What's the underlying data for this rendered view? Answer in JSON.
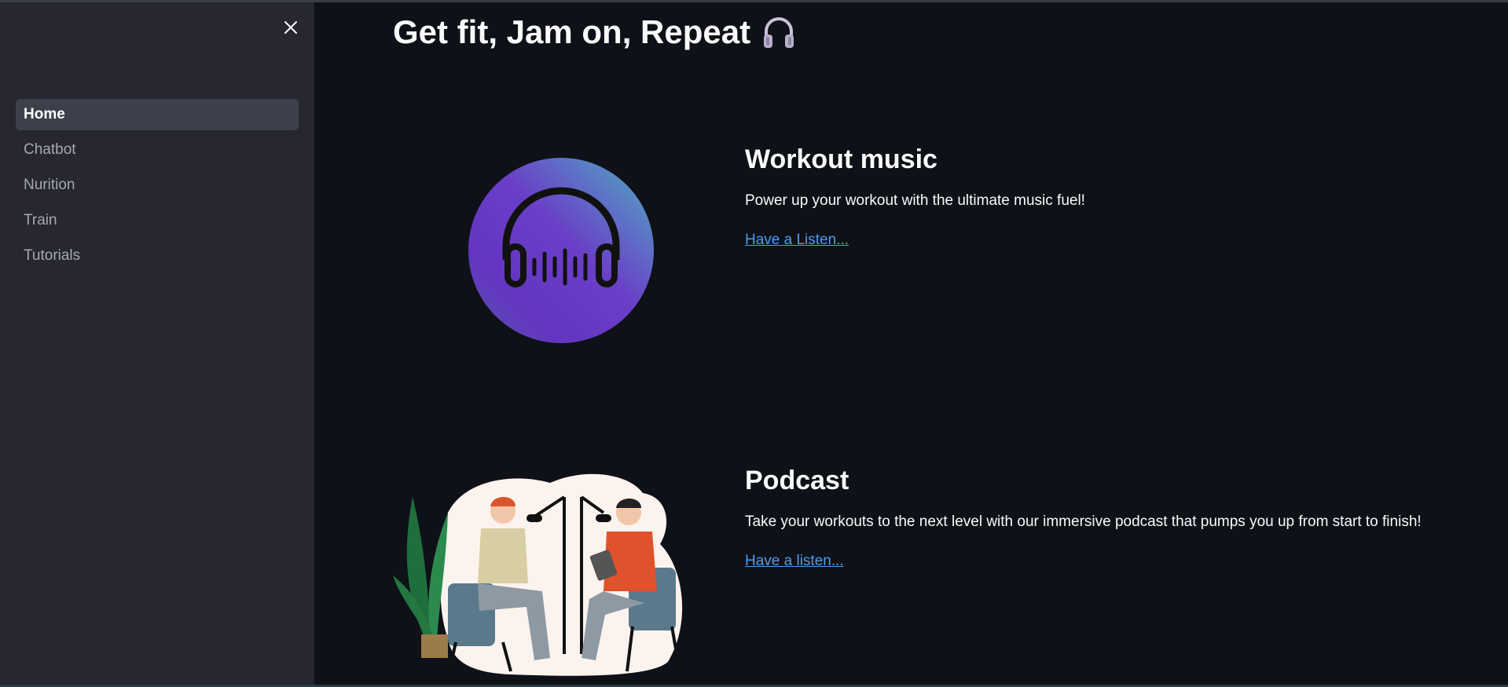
{
  "sidebar": {
    "close_icon": "close-icon",
    "items": [
      {
        "label": "Home",
        "active": true
      },
      {
        "label": "Chatbot",
        "active": false
      },
      {
        "label": "Nurition",
        "active": false
      },
      {
        "label": "Train",
        "active": false
      },
      {
        "label": "Tutorials",
        "active": false
      }
    ]
  },
  "main": {
    "title": "Get fit, Jam on, Repeat",
    "title_icon": "headphones-icon",
    "sections": [
      {
        "heading": "Workout music",
        "description": "Power up your workout with the ultimate music fuel!",
        "link": "Have a Listen...",
        "image": "music-logo-image"
      },
      {
        "heading": "Podcast",
        "description": "Take your workouts to the next level with our immersive podcast that pumps you up from start to finish!",
        "link": "Have a listen...",
        "image": "podcast-illustration"
      }
    ]
  },
  "colors": {
    "sidebar_bg": "#262730",
    "main_bg": "#0e1117",
    "active_item_bg": "#3d3f4b",
    "link": "#4c9cf0"
  }
}
